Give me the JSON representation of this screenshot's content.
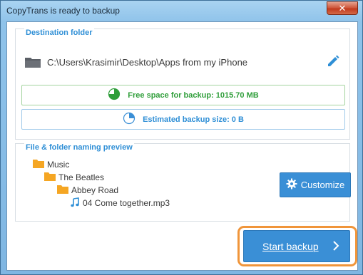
{
  "window": {
    "title": "CopyTrans is ready to backup",
    "close_label": "✕"
  },
  "destination": {
    "group_title": "Destination folder",
    "path": "C:\\Users\\Krasimir\\Desktop\\Apps from my iPhone",
    "free_space_label": "Free space for backup: 1015.70 MB",
    "free_space_fraction": 0.75,
    "estimated_size_label": "Estimated backup size: 0 B",
    "estimated_size_fraction": 0.25
  },
  "naming": {
    "group_title": "File & folder naming preview",
    "tree": [
      {
        "label": "Music",
        "type": "folder"
      },
      {
        "label": "The Beatles",
        "type": "folder"
      },
      {
        "label": "Abbey Road",
        "type": "folder"
      },
      {
        "label": "04 Come together.mp3",
        "type": "file"
      }
    ],
    "customize_label": "Customize"
  },
  "actions": {
    "start_backup_label": "Start backup"
  },
  "colors": {
    "accent": "#3a8fd6",
    "group_title": "#2f8fd6",
    "free_space_green": "#2f9e3a",
    "highlight_orange": "#f0953a",
    "folder_orange": "#f5a623"
  },
  "icons": [
    "close-icon",
    "folder-icon",
    "pencil-icon",
    "pie-chart-icon",
    "gear-icon",
    "music-note-icon",
    "chevron-right-icon"
  ]
}
